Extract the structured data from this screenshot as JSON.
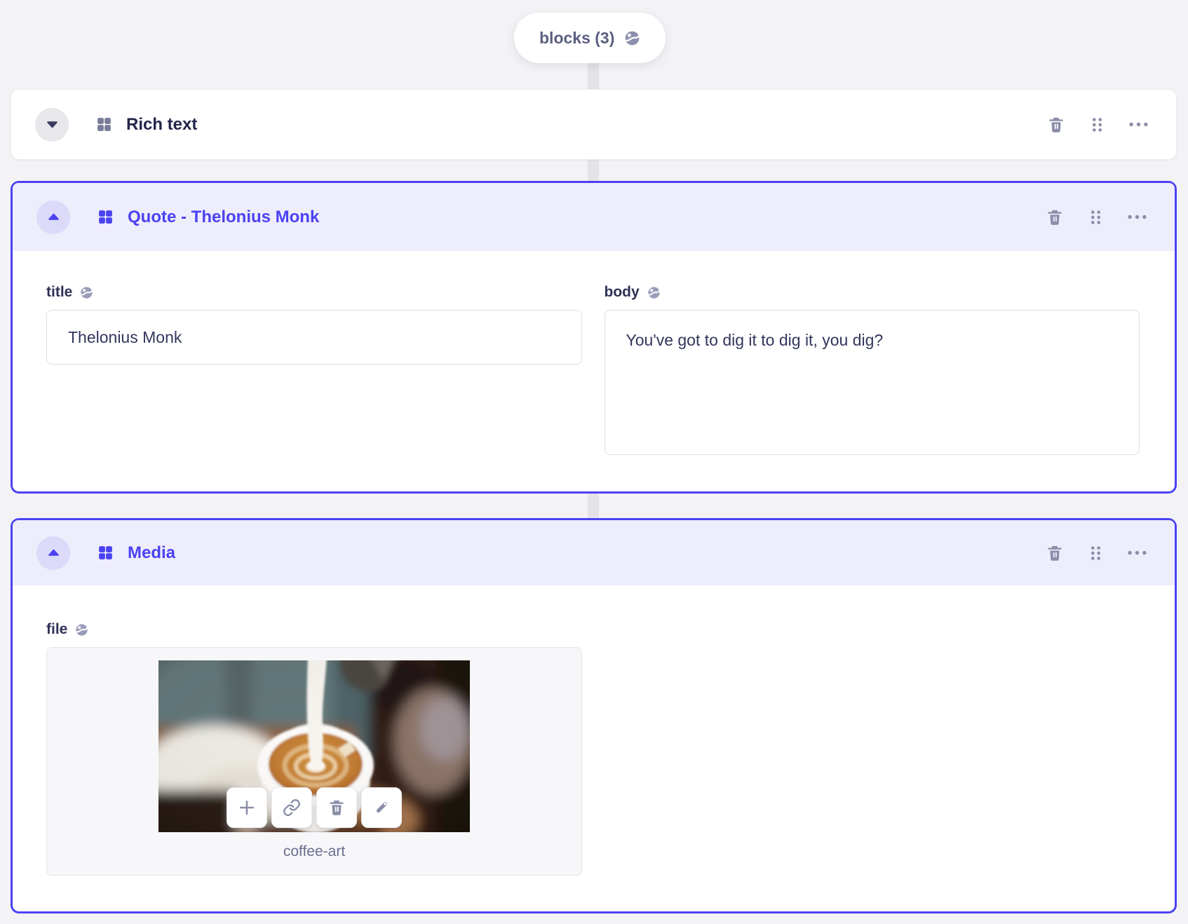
{
  "colors": {
    "page_bg": "#F3F3F6",
    "accent": "#4B42F2",
    "active_header_bg": "#EEEDFC",
    "icon_gray": "#8B8EA8",
    "title_dark": "#23264A"
  },
  "pill": {
    "label": "blocks (3)"
  },
  "blocks": {
    "rich": {
      "title": "Rich text"
    },
    "quote": {
      "title": "Quote - Thelonius Monk",
      "title_field": {
        "label": "title",
        "value": "Thelonius Monk"
      },
      "body_field": {
        "label": "body",
        "value": "You've got to dig it to dig it, you dig?"
      }
    },
    "media": {
      "title": "Media",
      "file_field": {
        "label": "file",
        "filename": "coffee-art"
      }
    }
  },
  "icons": {
    "pill": "globe-icon",
    "collapsed_block": "chevron-down-icon",
    "expanded_block": "chevron-up-icon",
    "block_type": "grid-icon",
    "row_actions": [
      "trash-icon",
      "drag-dots-icon",
      "ellipsis-icon"
    ],
    "localized_field": "globe-icon",
    "file_actions": [
      "plus-icon",
      "link-icon",
      "trash-icon",
      "pencil-icon"
    ]
  }
}
